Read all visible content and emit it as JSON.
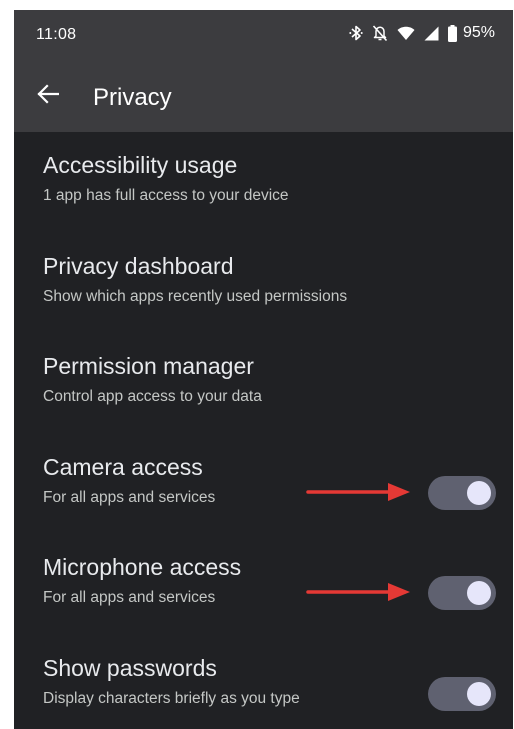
{
  "status_bar": {
    "time": "11:08",
    "battery": "95%",
    "icons": [
      "bluetooth-icon",
      "notifications-off-icon",
      "wifi-icon",
      "cell-signal-icon",
      "battery-icon"
    ]
  },
  "app_bar": {
    "title": "Privacy",
    "back_icon": "arrow-back-icon"
  },
  "settings": {
    "items": [
      {
        "title": "Accessibility usage",
        "summary": "1 app has full access to your device"
      },
      {
        "title": "Privacy dashboard",
        "summary": "Show which apps recently used permissions"
      },
      {
        "title": "Permission manager",
        "summary": "Control app access to your data"
      },
      {
        "title": "Camera access",
        "summary": "For all apps and services",
        "toggle": "on"
      },
      {
        "title": "Microphone access",
        "summary": "For all apps and services",
        "toggle": "on"
      },
      {
        "title": "Show passwords",
        "summary": "Display characters briefly as you type",
        "toggle": "on"
      }
    ]
  },
  "colors": {
    "background": "#202124",
    "app_bar": "#3c3c3f",
    "toggle_track": "#5f6170",
    "toggle_thumb": "#e6e6fa",
    "annotation_arrow": "#e53935"
  }
}
